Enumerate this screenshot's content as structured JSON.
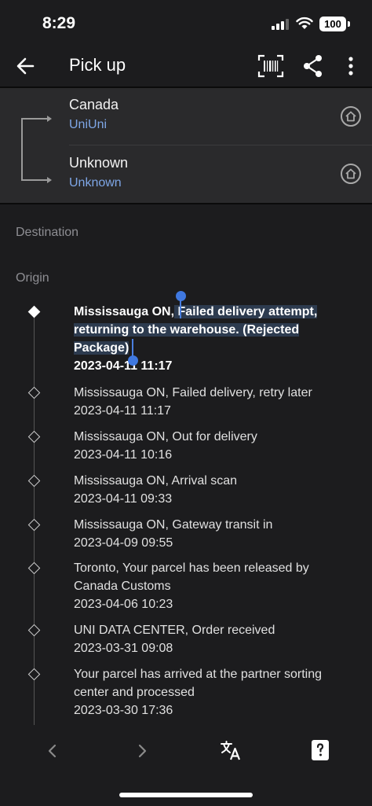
{
  "status_bar": {
    "time": "8:29",
    "battery": "100"
  },
  "header": {
    "title": "Pick up"
  },
  "route": {
    "from": {
      "name": "Canada",
      "carrier": "UniUni"
    },
    "to": {
      "name": "Unknown",
      "carrier": "Unknown"
    }
  },
  "sections": {
    "destination": "Destination",
    "origin": "Origin"
  },
  "events": [
    {
      "desc_a": "Mississauga ON,",
      "desc_b": " Failed delivery attempt, returning to the warehouse. (Rejected Package)",
      "time": "2023-04-11 11:17"
    },
    {
      "desc": "Mississauga ON, Failed delivery, retry later",
      "time": "2023-04-11 11:17"
    },
    {
      "desc": "Mississauga ON, Out for delivery",
      "time": "2023-04-11 10:16"
    },
    {
      "desc": "Mississauga ON, Arrival scan",
      "time": "2023-04-11 09:33"
    },
    {
      "desc": "Mississauga ON, Gateway transit in",
      "time": "2023-04-09 09:55"
    },
    {
      "desc": "Toronto, Your parcel has been released by Canada Customs",
      "time": "2023-04-06 10:23"
    },
    {
      "desc": "UNI DATA CENTER, Order received",
      "time": "2023-03-31 09:08"
    },
    {
      "desc": "Your parcel has arrived at the partner sorting center and processed",
      "time": "2023-03-30 17:36"
    }
  ],
  "icons": {
    "back": "arrow-left-icon",
    "barcode": "barcode-scan-icon",
    "share": "share-icon",
    "more": "more-vertical-icon",
    "home": "home-circle-icon",
    "prev": "chevron-left-icon",
    "next": "chevron-right-icon",
    "translate": "translate-icon",
    "help": "help-card-icon"
  },
  "colors": {
    "background": "#1c1c1e",
    "panel": "#2a2a2c",
    "link": "#7ea6e6",
    "selection": "#3f78e0"
  }
}
